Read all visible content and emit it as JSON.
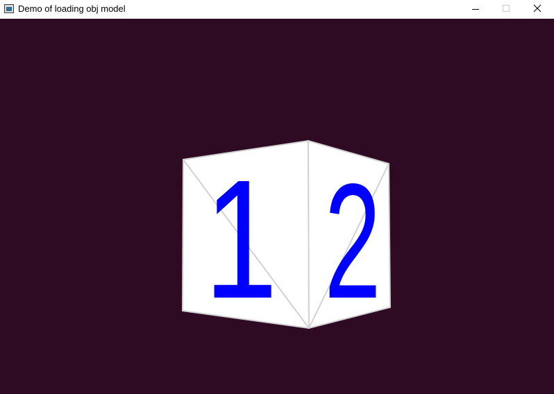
{
  "window": {
    "title": "Demo of loading obj model",
    "icon": "app-window-icon",
    "controls": [
      "minimize-icon",
      "maximize-icon",
      "close-icon"
    ]
  },
  "scene": {
    "background_color": "#2e0a23",
    "object": "cube",
    "faces": [
      {
        "label": "1",
        "color": "#0000ff"
      },
      {
        "label": "2",
        "color": "#0000ff"
      }
    ],
    "face_color": "#ffffff",
    "edge_color": "#d2d2d2"
  }
}
